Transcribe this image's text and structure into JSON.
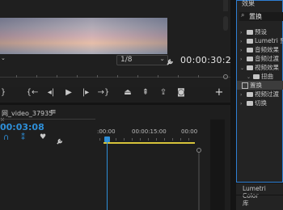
{
  "program_monitor": {
    "zoom_value": "",
    "quality_value": "1/8",
    "timecode": "00:00:30:26"
  },
  "transport": {
    "buttons": [
      "mark-in",
      "mark-out",
      "go-to-in",
      "step-back",
      "play",
      "step-forward",
      "go-to-out",
      "lift",
      "extract",
      "export-frame",
      "camera",
      "add"
    ]
  },
  "timeline": {
    "sequence_name": "网_video_37935",
    "menu_glyph": "≡",
    "timecode": "00:03:08",
    "ruler_labels": [
      ":00:00",
      "00:00:15:00",
      "00:00"
    ]
  },
  "effects_panel": {
    "title": "效果",
    "search_value": "置换",
    "tree": [
      {
        "label": "预设",
        "expanded": false,
        "depth": 0
      },
      {
        "label": "Lumetri 预",
        "expanded": false,
        "depth": 0
      },
      {
        "label": "音频效果",
        "expanded": false,
        "depth": 0
      },
      {
        "label": "音频过渡",
        "expanded": false,
        "depth": 0
      },
      {
        "label": "视频效果",
        "expanded": true,
        "depth": 0
      },
      {
        "label": "扭曲",
        "expanded": true,
        "depth": 1
      },
      {
        "label": "置换",
        "expanded": false,
        "depth": 2,
        "selected": true
      },
      {
        "label": "视频过渡",
        "expanded": false,
        "depth": 0
      },
      {
        "label": "切换",
        "expanded": false,
        "depth": 0
      }
    ]
  },
  "lumetri_panel": {
    "title": "Lumetri Color",
    "sub": "库"
  },
  "colors": {
    "accent_blue": "#2e8fd8",
    "inout_yellow": "#d6c33a",
    "panel_border": "#2e7fd4"
  }
}
